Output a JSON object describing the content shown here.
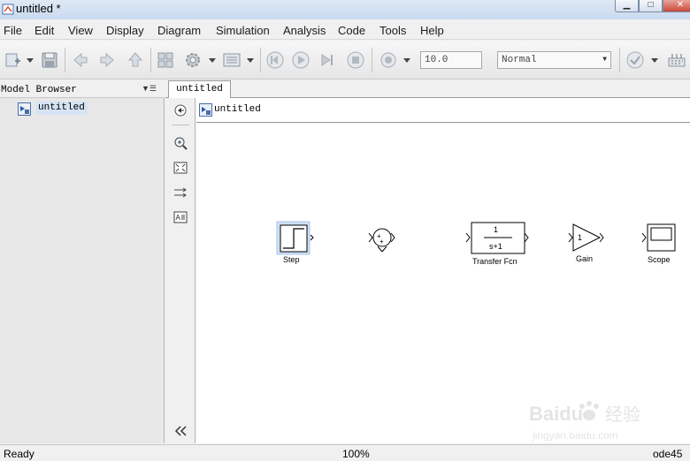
{
  "window": {
    "title": "untitled *"
  },
  "menu": [
    "File",
    "Edit",
    "View",
    "Display",
    "Diagram",
    "Simulation",
    "Analysis",
    "Code",
    "Tools",
    "Help"
  ],
  "toolbar": {
    "stop_time": "10.0",
    "sim_mode": "Normal"
  },
  "model_browser": {
    "title": "Model Browser",
    "tree_root": "untitled"
  },
  "tabs": [
    "untitled"
  ],
  "explorer": {
    "path": "untitled"
  },
  "blocks": {
    "step": "Step",
    "transfer_fcn": "Transfer Fcn",
    "tf_numerator": "1",
    "tf_denominator": "s+1",
    "gain": "Gain",
    "gain_value": "1",
    "scope": "Scope"
  },
  "status": {
    "left": "Ready",
    "zoom": "100%",
    "solver": "ode45"
  },
  "watermark": {
    "brand": "Baidu",
    "brand_cn": "经验",
    "url": "jingyan.baidu.com"
  },
  "colors": {
    "title_bar": "#c9d9ee",
    "close_button": "#c8483a",
    "selection": "#d5e3f5",
    "canvas": "#ffffff"
  }
}
